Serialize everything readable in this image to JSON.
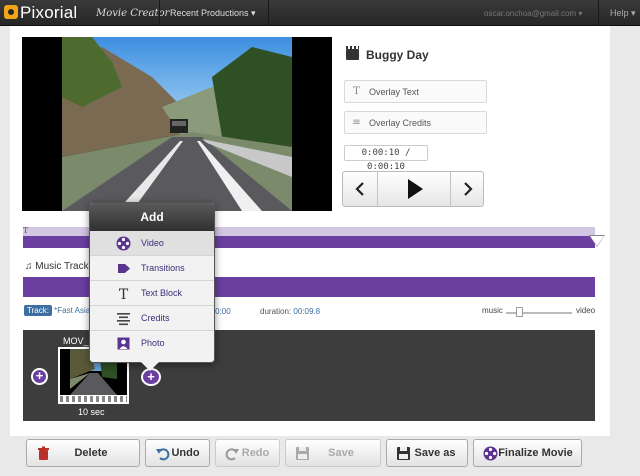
{
  "topbar": {
    "brand": "Pixorial",
    "brand_sub": "Movie Creator",
    "recent_menu": "Recent Productions ▾",
    "account": "oscar.onchoa@gmail.com ▾",
    "help": "Help ▾"
  },
  "project": {
    "title": "Buggy Day",
    "overlay_text": "Overlay Text",
    "overlay_credits": "Overlay Credits",
    "timecode": "0:00:10 / 0:00:10"
  },
  "timeline": {
    "text_track_marker": "T",
    "music_label": "♫ Music Track",
    "track_badge": "Track:",
    "song": "*Fast Asia",
    "start_label": "t:",
    "start_value": "00:00",
    "duration_label": "duration:",
    "duration_value": "00:09.8",
    "mix_music": "music",
    "mix_video": "video",
    "mix_level": 0.2
  },
  "storyboard": {
    "clip_name": "MOV_",
    "clip_duration": "10 sec",
    "add_symbol": "+"
  },
  "toolbar": {
    "delete": "Delete",
    "undo": "Undo",
    "redo": "Redo",
    "save": "Save",
    "save_as": "Save as",
    "finalize": "Finalize Movie"
  },
  "add_menu": {
    "title": "Add",
    "items": [
      {
        "label": "Video",
        "icon": "film-reel-icon"
      },
      {
        "label": "Transitions",
        "icon": "arrow-right-icon"
      },
      {
        "label": "Text Block",
        "icon": "text-icon"
      },
      {
        "label": "Credits",
        "icon": "list-icon"
      },
      {
        "label": "Photo",
        "icon": "portrait-icon"
      }
    ]
  },
  "colors": {
    "accent": "#6a3fa0",
    "topbar": "#2b2b2b",
    "link": "#3e6fa3"
  }
}
